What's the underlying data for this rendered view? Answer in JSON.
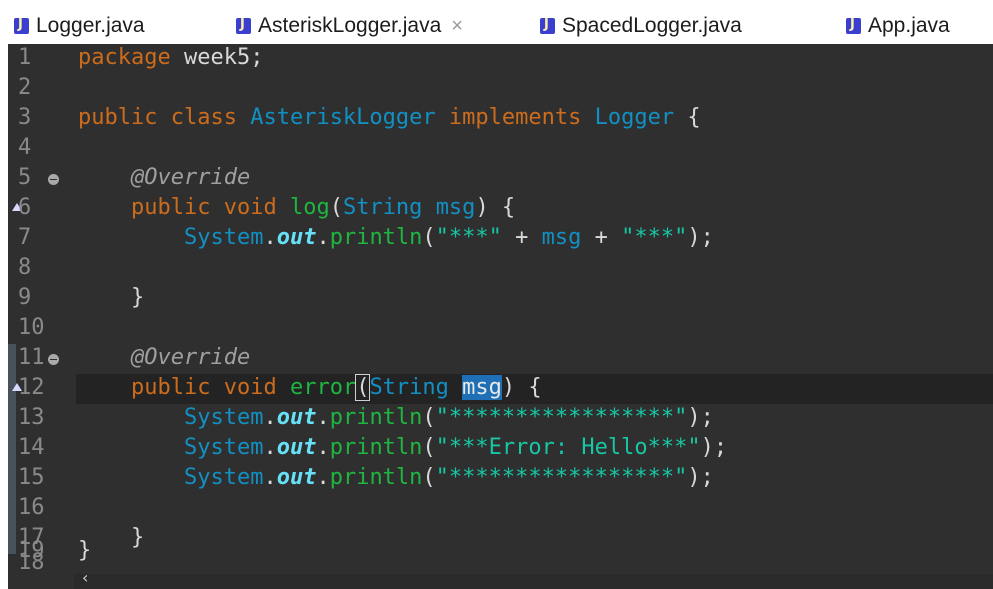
{
  "tabs": [
    {
      "label": "Logger.java"
    },
    {
      "label": "AsteriskLogger.java",
      "close": "×"
    },
    {
      "label": "SpacedLogger.java"
    },
    {
      "label": "App.java"
    }
  ],
  "lines": [
    {
      "num": "1"
    },
    {
      "num": "2"
    },
    {
      "num": "3"
    },
    {
      "num": "4"
    },
    {
      "num": "5"
    },
    {
      "num": "6"
    },
    {
      "num": "7"
    },
    {
      "num": "8"
    },
    {
      "num": "9"
    },
    {
      "num": "10"
    },
    {
      "num": "11"
    },
    {
      "num": "12"
    },
    {
      "num": "13"
    },
    {
      "num": "14"
    },
    {
      "num": "15"
    },
    {
      "num": "16"
    },
    {
      "num": "17"
    },
    {
      "num": "18"
    },
    {
      "num": "19"
    }
  ],
  "code": {
    "package_kw": "package",
    "package_name": " week5;",
    "public": "public",
    "class": "class",
    "class_name": "AsteriskLogger",
    "implements": "implements",
    "iface": "Logger",
    "open_brace": " {",
    "close_brace": "}",
    "override": "@Override",
    "void": "void",
    "log": "log",
    "error": "error",
    "string_type": "String",
    "msg": "msg",
    "system": "System",
    "out": "out",
    "println": "println",
    "str_three": "\"***\"",
    "str_stars": "\"*****************\"",
    "str_error": "\"***Error: Hello***\""
  },
  "scrollbar": {
    "arrow": "‹"
  }
}
